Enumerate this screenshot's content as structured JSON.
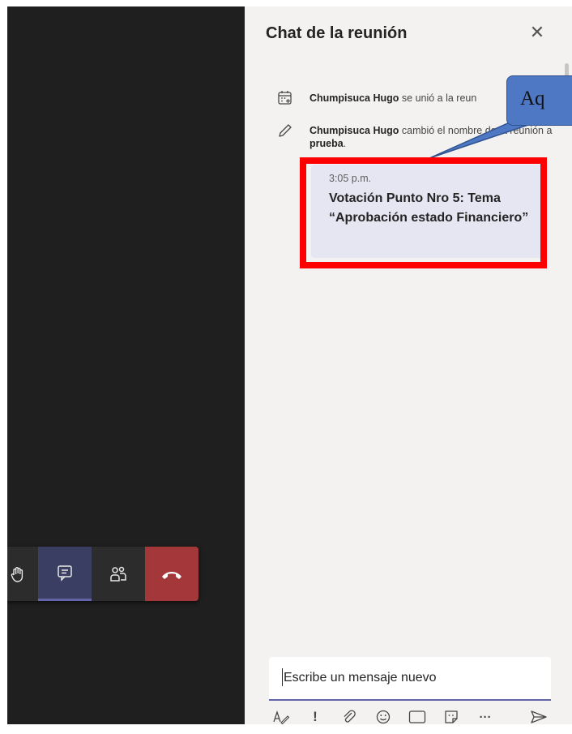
{
  "chat": {
    "title": "Chat de la reunión",
    "close_icon": "close-icon",
    "events": [
      {
        "icon": "calendar-add-icon",
        "name": "Chumpisuca Hugo",
        "text": " se unió a la reun"
      },
      {
        "icon": "pencil-icon",
        "name": "Chumpisuca Hugo",
        "text_before": " cambió el nombre de la reunión a ",
        "bold_value": "prueba",
        "text_after": "."
      }
    ],
    "message": {
      "time": "3:05 p.m.",
      "text": "Votación Punto Nro 5: Tema “Aprobación estado Financiero”"
    },
    "compose": {
      "placeholder": "Escribe un mensaje nuevo"
    },
    "tools": [
      {
        "name": "format-icon",
        "glyph": "A"
      },
      {
        "name": "important-icon",
        "glyph": "!"
      },
      {
        "name": "attach-icon",
        "glyph": "📎"
      },
      {
        "name": "emoji-icon",
        "glyph": "☺"
      },
      {
        "name": "gif-icon",
        "glyph": "GIF"
      },
      {
        "name": "sticker-icon",
        "glyph": "▣"
      },
      {
        "name": "more-icon",
        "glyph": "···"
      },
      {
        "name": "send-icon",
        "glyph": "➢"
      }
    ]
  },
  "callout": {
    "text": "Aq"
  },
  "toolbar": {
    "buttons": [
      "raise-hand-icon",
      "chat-icon",
      "participants-icon",
      "hangup-icon"
    ]
  },
  "colors": {
    "highlight": "#ff0000",
    "callout_fill": "#4f78c4",
    "hangup": "#a4373a",
    "accent": "#6264a7"
  }
}
